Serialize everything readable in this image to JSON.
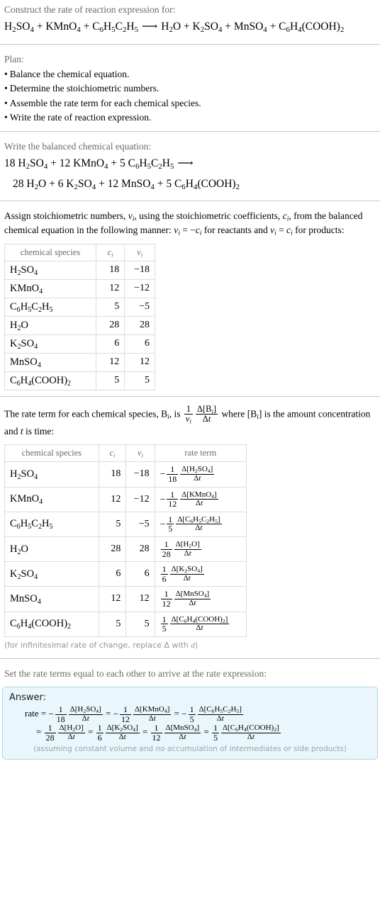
{
  "header": {
    "prompt": "Construct the rate of reaction expression for:",
    "reaction_reactants": [
      "H2SO4",
      "KMnO4",
      "C6H5C2H5"
    ],
    "reaction_products": [
      "H2O",
      "K2SO4",
      "MnSO4",
      "C6H4(COOH)2"
    ],
    "arrow": "⟶"
  },
  "plan": {
    "label": "Plan:",
    "items": [
      "Balance the chemical equation.",
      "Determine the stoichiometric numbers.",
      "Assemble the rate term for each chemical species.",
      "Write the rate of reaction expression."
    ],
    "bullet": "•"
  },
  "balanced": {
    "label": "Write the balanced chemical equation:",
    "line1": "18 H2SO4 + 12 KMnO4 + 5 C6H5C2H5  ⟶",
    "line2": "28 H2O + 6 K2SO4 + 12 MnSO4 + 5 C6H4(COOH)2",
    "reactant_coeffs": [
      18,
      12,
      5
    ],
    "product_coeffs": [
      28,
      6,
      12,
      5
    ]
  },
  "stoich": {
    "intro_part1": "Assign stoichiometric numbers, ",
    "intro_nu": "ν",
    "intro_part2": ", using the stoichiometric coefficients, ",
    "intro_c": "c",
    "intro_part3": ", from the balanced chemical equation in the following manner: ",
    "intro_rule1": "ν",
    "intro_part4": " = −",
    "intro_part5": " for reactants and ",
    "intro_part6": " = ",
    "intro_part7": " for products:",
    "headers": {
      "species": "chemical species",
      "ci": "c",
      "nui": "ν",
      "sub_i": "i"
    },
    "rows": [
      {
        "species": "H2SO4",
        "ci": "18",
        "nui": "−18"
      },
      {
        "species": "KMnO4",
        "ci": "12",
        "nui": "−12"
      },
      {
        "species": "C6H5C2H5",
        "ci": "5",
        "nui": "−5"
      },
      {
        "species": "H2O",
        "ci": "28",
        "nui": "28"
      },
      {
        "species": "K2SO4",
        "ci": "6",
        "nui": "6"
      },
      {
        "species": "MnSO4",
        "ci": "12",
        "nui": "12"
      },
      {
        "species": "C6H4(COOH)2",
        "ci": "5",
        "nui": "5"
      }
    ]
  },
  "rateterm": {
    "intro_a": "The rate term for each chemical species, ",
    "intro_b": ", is ",
    "intro_c": " where ",
    "intro_d": " is the amount concentration and ",
    "intro_t": "t",
    "intro_e": " is time:",
    "B": "B",
    "one": "1",
    "nu": "ν",
    "delta_num": "Δ[B",
    "delta_den": "Δt",
    "headers": {
      "species": "chemical species",
      "ci": "c",
      "nui": "ν",
      "rate": "rate term"
    },
    "rows": [
      {
        "species": "H2SO4",
        "ci": "18",
        "nui": "−18",
        "sign": "−",
        "denom": "18",
        "conc": "H2SO4"
      },
      {
        "species": "KMnO4",
        "ci": "12",
        "nui": "−12",
        "sign": "−",
        "denom": "12",
        "conc": "KMnO4"
      },
      {
        "species": "C6H5C2H5",
        "ci": "5",
        "nui": "−5",
        "sign": "−",
        "denom": "5",
        "conc": "C6H5C2H5"
      },
      {
        "species": "H2O",
        "ci": "28",
        "nui": "28",
        "sign": "",
        "denom": "28",
        "conc": "H2O"
      },
      {
        "species": "K2SO4",
        "ci": "6",
        "nui": "6",
        "sign": "",
        "denom": "6",
        "conc": "K2SO4"
      },
      {
        "species": "MnSO4",
        "ci": "12",
        "nui": "12",
        "sign": "",
        "denom": "12",
        "conc": "MnSO4"
      },
      {
        "species": "C6H4(COOH)2",
        "ci": "5",
        "nui": "5",
        "sign": "",
        "denom": "5",
        "conc": "C6H4(COOH)2"
      }
    ],
    "footnote": "(for infinitesimal rate of change, replace Δ with d)"
  },
  "final": {
    "label": "Set the rate terms equal to each other to arrive at the rate expression:",
    "answer_label": "Answer:",
    "rate_word": "rate",
    "equals": "=",
    "note": "(assuming constant volume and no accumulation of intermediates or side products)",
    "terms": [
      {
        "sign": "−",
        "denom": "18",
        "conc": "H2SO4"
      },
      {
        "sign": "−",
        "denom": "12",
        "conc": "KMnO4"
      },
      {
        "sign": "−",
        "denom": "5",
        "conc": "C6H5C2H5"
      },
      {
        "sign": "",
        "denom": "28",
        "conc": "H2O"
      },
      {
        "sign": "",
        "denom": "6",
        "conc": "K2SO4"
      },
      {
        "sign": "",
        "denom": "12",
        "conc": "MnSO4"
      },
      {
        "sign": "",
        "denom": "5",
        "conc": "C6H4(COOH)2"
      }
    ]
  },
  "colors": {
    "separator": "#c8c8c8",
    "table_border": "#dcdcdc",
    "muted_text": "#6b6b6b",
    "answer_bg": "#e9f7fc",
    "answer_border": "#a8d8e8",
    "note_text": "#9aa5a8"
  }
}
